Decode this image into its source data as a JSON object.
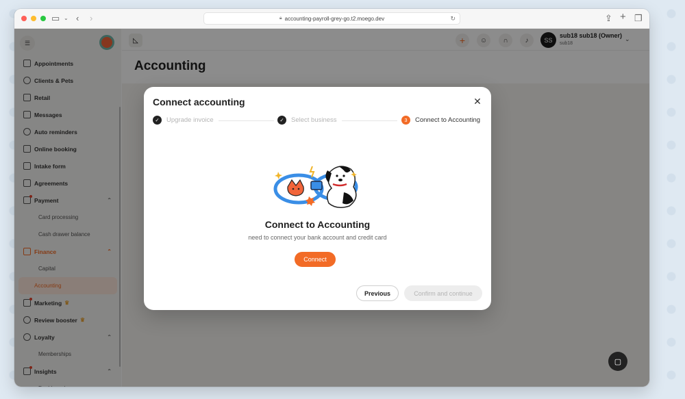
{
  "browser": {
    "url": "accounting-payroll-grey-go.t2.moego.dev"
  },
  "sidebar": {
    "items": [
      {
        "label": "Appointments"
      },
      {
        "label": "Clients & Pets"
      },
      {
        "label": "Retail"
      },
      {
        "label": "Messages"
      },
      {
        "label": "Auto reminders"
      },
      {
        "label": "Online booking"
      },
      {
        "label": "Intake form"
      },
      {
        "label": "Agreements"
      },
      {
        "label": "Payment"
      },
      {
        "label": "Finance"
      },
      {
        "label": "Marketing"
      },
      {
        "label": "Review booster"
      },
      {
        "label": "Loyalty"
      },
      {
        "label": "Insights"
      }
    ],
    "payment_sub": [
      "Card processing",
      "Cash drawer balance"
    ],
    "finance_sub": [
      "Capital",
      "Accounting"
    ],
    "loyalty_sub": [
      "Memberships"
    ],
    "insights_sub": [
      "Dashboard"
    ],
    "active_item": "Accounting",
    "accent_color": "#f26b26"
  },
  "header": {
    "user_initials": "SS",
    "user_name": "sub18 sub18 (Owner)",
    "user_sub": "sub18"
  },
  "page": {
    "title": "Accounting"
  },
  "modal": {
    "title": "Connect accounting",
    "steps": [
      {
        "label": "Upgrade invoice",
        "status": "done"
      },
      {
        "label": "Select business",
        "status": "done"
      },
      {
        "label": "Connect to Accounting",
        "status": "current",
        "number": "3"
      }
    ],
    "hero_title": "Connect to Accounting",
    "hero_subtitle": "need to connect your bank account and credit card",
    "connect_label": "Connect",
    "previous_label": "Previous",
    "confirm_label": "Confirm and continue"
  }
}
